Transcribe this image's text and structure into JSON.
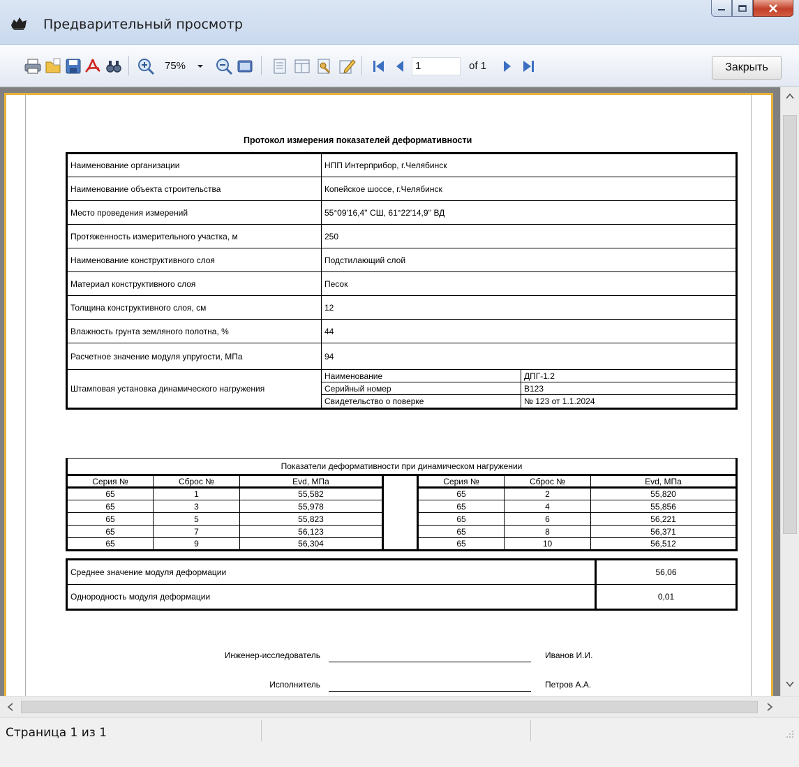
{
  "window": {
    "title": "Предварительный просмотр"
  },
  "toolbar": {
    "zoom_value": "75%",
    "page_current": "1",
    "page_of": "of 1",
    "close_label": "Закрыть",
    "icons": [
      "printer-icon",
      "open-icon",
      "save-icon",
      "pdf-icon",
      "find-icon",
      "zoom-in-icon",
      "zoom-out-icon",
      "fit-page-icon",
      "page-setup-icon",
      "columns-icon",
      "parameters-icon",
      "edit-icon",
      "first-page-icon",
      "prev-page-icon",
      "next-page-icon",
      "last-page-icon"
    ]
  },
  "document": {
    "title": "Протокол измерения  показателей деформативности",
    "info": [
      {
        "label": "Наименование организации",
        "value": "НПП Интерприбор, г.Челябинск"
      },
      {
        "label": "Наименование объекта строительства",
        "value": "Копейское шоссе, г.Челябинск"
      },
      {
        "label": "Место проведения измерений",
        "value": "55°09'16,4'' СШ, 61°22'14,9'' ВД"
      },
      {
        "label": "Протяженность измерительного участка, м",
        "value": "250"
      },
      {
        "label": "Наименование конструктивного слоя",
        "value": "Подстилающий слой"
      },
      {
        "label": "Материал конструктивного слоя",
        "value": "Песок"
      },
      {
        "label": "Толщина конструктивного слоя, см",
        "value": "12"
      },
      {
        "label": "Влажность грунта земляного полотна, %",
        "value": "44"
      },
      {
        "label": "Расчетное значение модуля упругости, МПа",
        "value": "94"
      }
    ],
    "device": {
      "label": "Штамповая установка динамического нагружения",
      "rows": [
        {
          "key": "Наименование",
          "value": "ДПГ-1.2"
        },
        {
          "key": "Серийный номер",
          "value": "В123"
        },
        {
          "key": "Свидетельство о поверке",
          "value": "№ 123 от 1.1.2024"
        }
      ]
    },
    "measurements": {
      "caption": "Показатели деформативности при динамическом нагружении",
      "headers": [
        "Серия №",
        "Сброс №",
        "Evd, МПа"
      ],
      "left": [
        [
          "65",
          "1",
          "55,582"
        ],
        [
          "65",
          "3",
          "55,978"
        ],
        [
          "65",
          "5",
          "55,823"
        ],
        [
          "65",
          "7",
          "56,123"
        ],
        [
          "65",
          "9",
          "56,304"
        ]
      ],
      "right": [
        [
          "65",
          "2",
          "55,820"
        ],
        [
          "65",
          "4",
          "55,856"
        ],
        [
          "65",
          "6",
          "56,221"
        ],
        [
          "65",
          "8",
          "56,371"
        ],
        [
          "65",
          "10",
          "56,512"
        ]
      ]
    },
    "summary": [
      {
        "label": "Среднее значение модуля деформации",
        "value": "56,06"
      },
      {
        "label": "Однородность модуля деформации",
        "value": "0,01"
      }
    ],
    "signatures": [
      {
        "role": "Инженер-исследователь",
        "name": "Иванов И.И."
      },
      {
        "role": "Исполнитель",
        "name": "Петров А.А."
      }
    ]
  },
  "status": {
    "page_text": "Страница 1 из 1"
  }
}
